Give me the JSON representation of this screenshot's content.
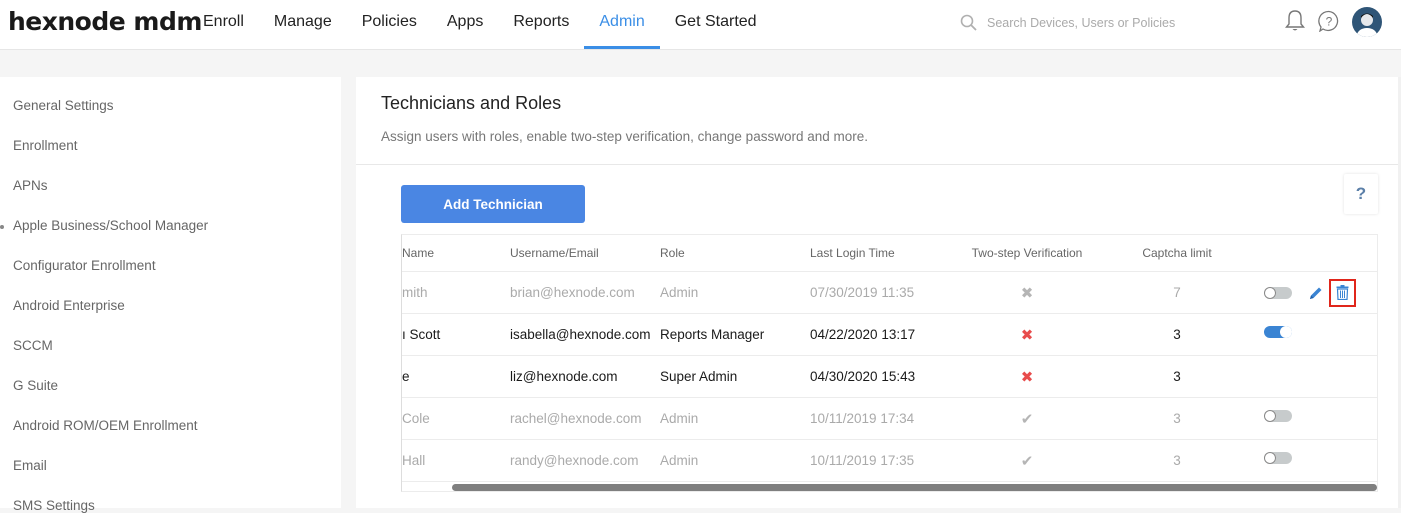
{
  "app": {
    "logo": "hexnode mdm"
  },
  "nav": {
    "items": [
      {
        "label": "Enroll",
        "active": false
      },
      {
        "label": "Manage",
        "active": false
      },
      {
        "label": "Policies",
        "active": false
      },
      {
        "label": "Apps",
        "active": false
      },
      {
        "label": "Reports",
        "active": false
      },
      {
        "label": "Admin",
        "active": true
      },
      {
        "label": "Get Started",
        "active": false
      }
    ],
    "search_placeholder": "Search Devices, Users or Policies",
    "icons": {
      "search": "search-icon",
      "notifications": "bell-icon",
      "help": "help-circle-icon",
      "profile": "avatar"
    },
    "accent_color": "#3a8ee6"
  },
  "sidebar": {
    "items": [
      {
        "label": "General Settings"
      },
      {
        "label": "Enrollment"
      },
      {
        "label": "APNs"
      },
      {
        "label": "Apple Business/School Manager",
        "marker": true
      },
      {
        "label": "Configurator Enrollment"
      },
      {
        "label": "Android Enterprise"
      },
      {
        "label": "SCCM"
      },
      {
        "label": "G Suite"
      },
      {
        "label": "Android ROM/OEM Enrollment"
      },
      {
        "label": "Email"
      },
      {
        "label": "SMS Settings"
      }
    ]
  },
  "page": {
    "title": "Technicians and Roles",
    "subtitle": "Assign users with roles, enable two-step verification, change password and more.",
    "add_button": "Add Technician",
    "help_button": "?",
    "button_color": "#4a86e3"
  },
  "table": {
    "columns": [
      "Name",
      "Username/Email",
      "Role",
      "Last Login Time",
      "Two-step Verification",
      "Captcha limit"
    ],
    "rows": [
      {
        "name": "mith",
        "email": "brian@hexnode.com",
        "role": "Admin",
        "last_login": "07/30/2019 11:35",
        "two_step": "disabled-x",
        "captcha": "7",
        "status": "disabled",
        "toggle": "off",
        "has_edit": true,
        "has_delete": true
      },
      {
        "name": "ı Scott",
        "email": "isabella@hexnode.com",
        "role": "Reports Manager",
        "last_login": "04/22/2020 13:17",
        "two_step": "x",
        "captcha": "3",
        "status": "enabled",
        "toggle": "on",
        "has_edit": false,
        "has_delete": false
      },
      {
        "name": "e",
        "email": "liz@hexnode.com",
        "role": "Super Admin",
        "last_login": "04/30/2020 15:43",
        "two_step": "x",
        "captcha": "3",
        "status": "enabled",
        "toggle": "none",
        "has_edit": false,
        "has_delete": false
      },
      {
        "name": "Cole",
        "email": "rachel@hexnode.com",
        "role": "Admin",
        "last_login": "10/11/2019 17:34",
        "two_step": "check",
        "captcha": "3",
        "status": "disabled",
        "toggle": "off",
        "has_edit": false,
        "has_delete": false
      },
      {
        "name": "Hall",
        "email": "randy@hexnode.com",
        "role": "Admin",
        "last_login": "10/11/2019 17:35",
        "two_step": "check",
        "captcha": "3",
        "status": "disabled",
        "toggle": "off",
        "has_edit": false,
        "has_delete": false
      }
    ],
    "glyphs": {
      "x": "✖",
      "check": "✔"
    },
    "status_colors": {
      "x": "#e84c4c",
      "muted": "#b5b5b5",
      "toggle_on": "#3a84d3",
      "delete_highlight": "#e0261b"
    }
  }
}
